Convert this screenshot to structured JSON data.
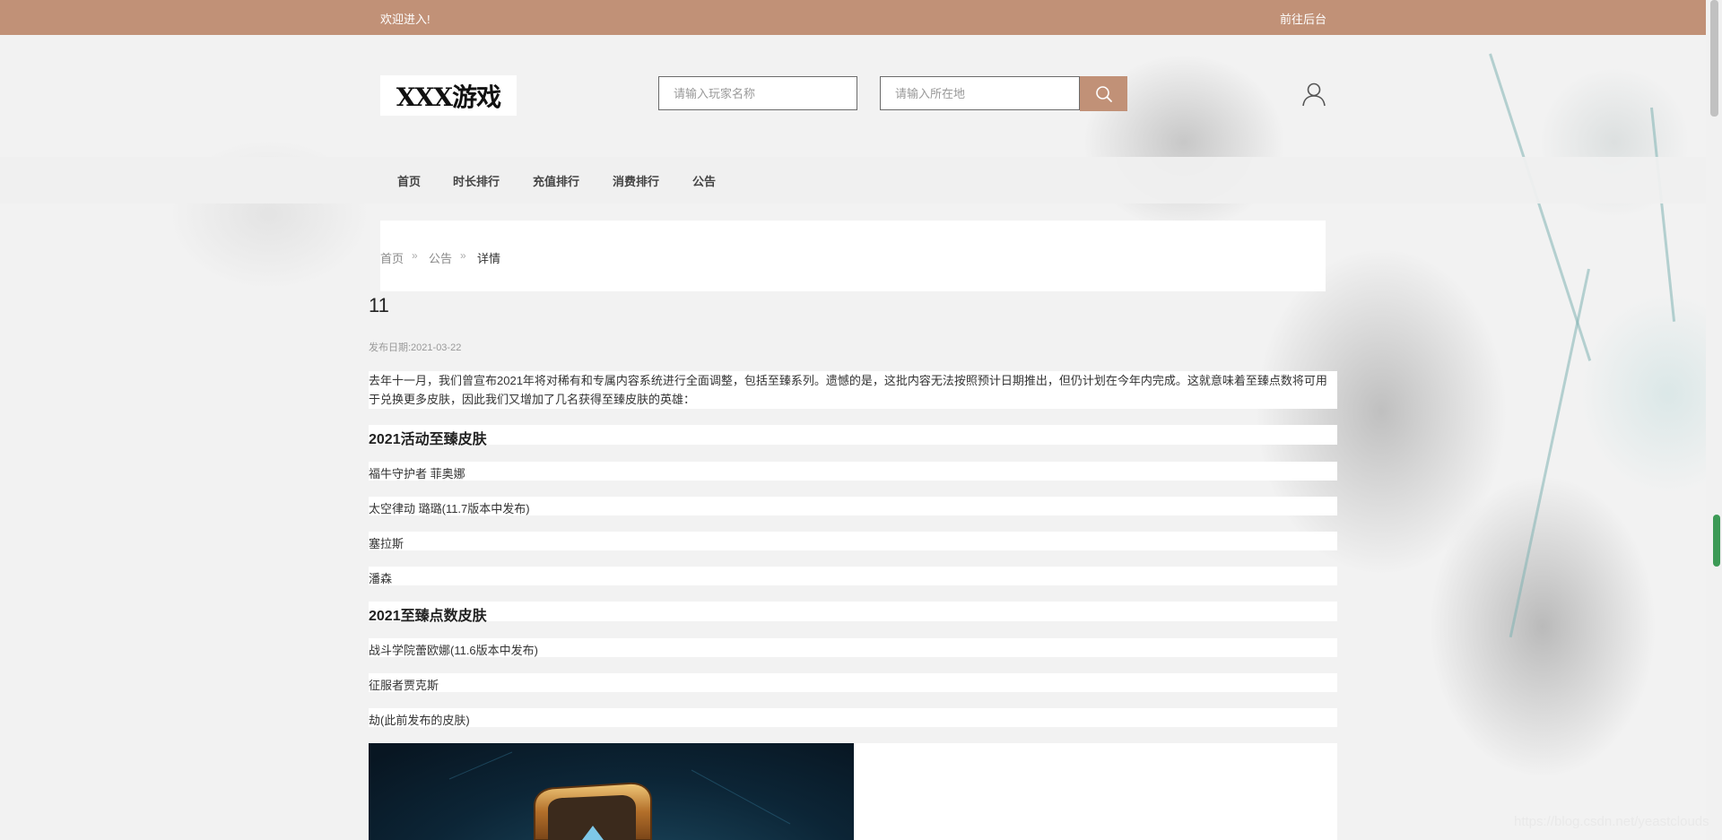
{
  "topbar": {
    "welcome": "欢迎进入!",
    "admin_link": "前往后台"
  },
  "header": {
    "logo": "XXX游戏",
    "player_placeholder": "请输入玩家名称",
    "location_placeholder": "请输入所在地"
  },
  "nav": [
    "首页",
    "时长排行",
    "充值排行",
    "消费排行",
    "公告"
  ],
  "breadcrumb": {
    "home": "首页",
    "section": "公告",
    "current": "详情"
  },
  "article": {
    "title": "11",
    "date": "发布日期:2021-03-22",
    "intro": "去年十一月，我们曾宣布2021年将对稀有和专属内容系统进行全面调整，包括至臻系列。遗憾的是，这批内容无法按照预计日期推出，但仍计划在今年内完成。这就意味着至臻点数将可用于兑换更多皮肤，因此我们又增加了几名获得至臻皮肤的英雄：",
    "section1_heading": "2021活动至臻皮肤",
    "section1_items": [
      "福牛守护者 菲奥娜",
      "太空律动 璐璐(11.7版本中发布)",
      "塞拉斯",
      "潘森"
    ],
    "section2_heading": "2021至臻点数皮肤",
    "section2_items": [
      "战斗学院蕾欧娜(11.6版本中发布)",
      "征服者贾克斯",
      "劫(此前发布的皮肤)"
    ]
  },
  "watermark": "https://blog.csdn.net/yeastclouds",
  "colors": {
    "accent": "#c19177",
    "scroll_indicator": "#3c9a56"
  }
}
